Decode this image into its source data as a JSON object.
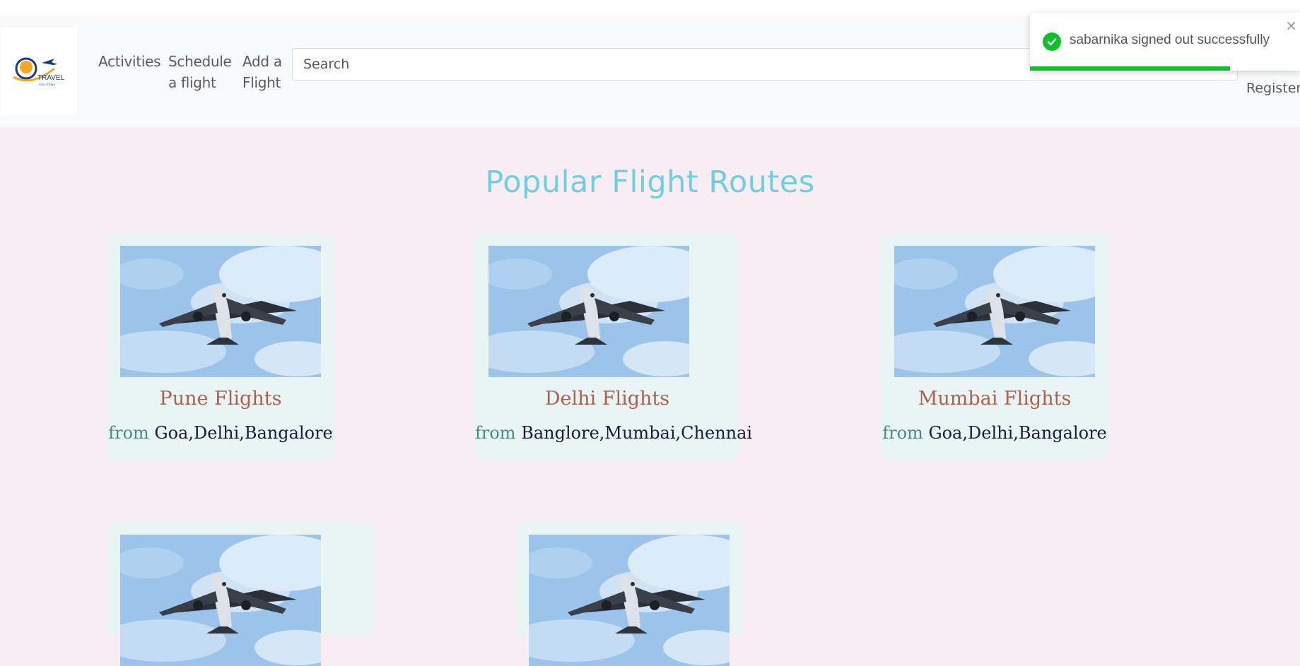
{
  "nav": {
    "logo_text": "TRAVEL",
    "logo_sub": "SOLUTIONS",
    "activities": "Activities",
    "schedule_line1": "Schedule",
    "schedule_line2": "a flight",
    "add_line1": "Add a",
    "add_line2": "Flight",
    "search_placeholder": "Search",
    "register": "Register"
  },
  "main": {
    "heading": "Popular Flight Routes",
    "from_label": "from",
    "cards": [
      {
        "title": "Pune Flights",
        "routes": "Goa,Delhi,Bangalore"
      },
      {
        "title": "Delhi Flights",
        "routes": "Banglore,Mumbai,Chennai"
      },
      {
        "title": "Mumbai Flights",
        "routes": "Goa,Delhi,Bangalore"
      }
    ]
  },
  "toast": {
    "message": "sabarnika signed out successfully",
    "close": "×",
    "progress": 0.74,
    "color": "#0fbf2f"
  },
  "colors": {
    "heading": "#6dd0e2",
    "card_title": "#b0604a",
    "page_bg": "#f9edf4"
  }
}
